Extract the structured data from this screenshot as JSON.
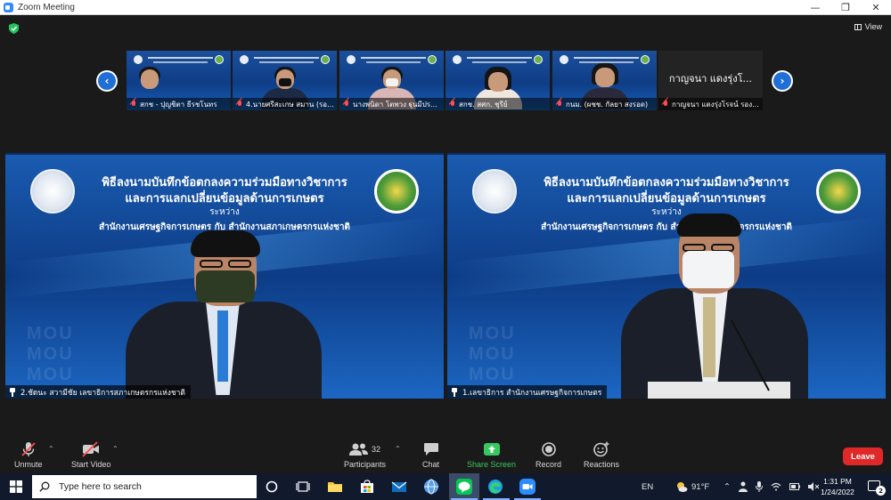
{
  "window": {
    "title": "Zoom Meeting"
  },
  "top_bar": {
    "view_label": "View"
  },
  "thumbnails": [
    {
      "name": "สกช - ปุญชิตา ธีรชโนทร"
    },
    {
      "name": "4.นายศรีสะเกษ สมาน (รอ..."
    },
    {
      "name": "นางพนิดา โตพวง ฐุนมีปร..."
    },
    {
      "name": "สกช. สศก. ชุรีย์"
    },
    {
      "name": "กนม. (ผชช. กัลยา สงรอด)"
    },
    {
      "name": "กาญจนา แดงรุ่งโรจน์ รอง...",
      "big_name": "กาญจนา แดงรุ่งโ..."
    }
  ],
  "slide": {
    "line1": "พิธีลงนามบันทึกข้อตกลงความร่วมมือทางวิชาการ",
    "line2": "และการแลกเปลี่ยนข้อมูลด้านการเกษตร",
    "line3": "ระหว่าง",
    "line4": "สำนักงานเศรษฐกิจการเกษตร กับ สำนักงานสภาเกษตรกรแห่งชาติ",
    "watermark": "MOU"
  },
  "main_tiles": [
    {
      "name": "2.ชัดนะ สวามีชัย เลขาธิการสภาเกษตรกรแห่งชาติ"
    },
    {
      "name": "1.เลขาธิการ สำนักงานเศรษฐกิจการเกษตร"
    }
  ],
  "toolbar": {
    "unmute": "Unmute",
    "start_video": "Start Video",
    "participants": "Participants",
    "participants_count": "32",
    "chat": "Chat",
    "share_screen": "Share Screen",
    "record": "Record",
    "reactions": "Reactions",
    "leave": "Leave"
  },
  "taskbar": {
    "search_placeholder": "Type here to search",
    "language": "EN",
    "weather": "91°F",
    "time": "1:31 PM",
    "date": "1/24/2022",
    "notifications": "2"
  },
  "colors": {
    "zoom_blue": "#2d8cff",
    "leave_red": "#e02828",
    "share_green": "#37c85f",
    "taskbar": "#101a2c"
  }
}
